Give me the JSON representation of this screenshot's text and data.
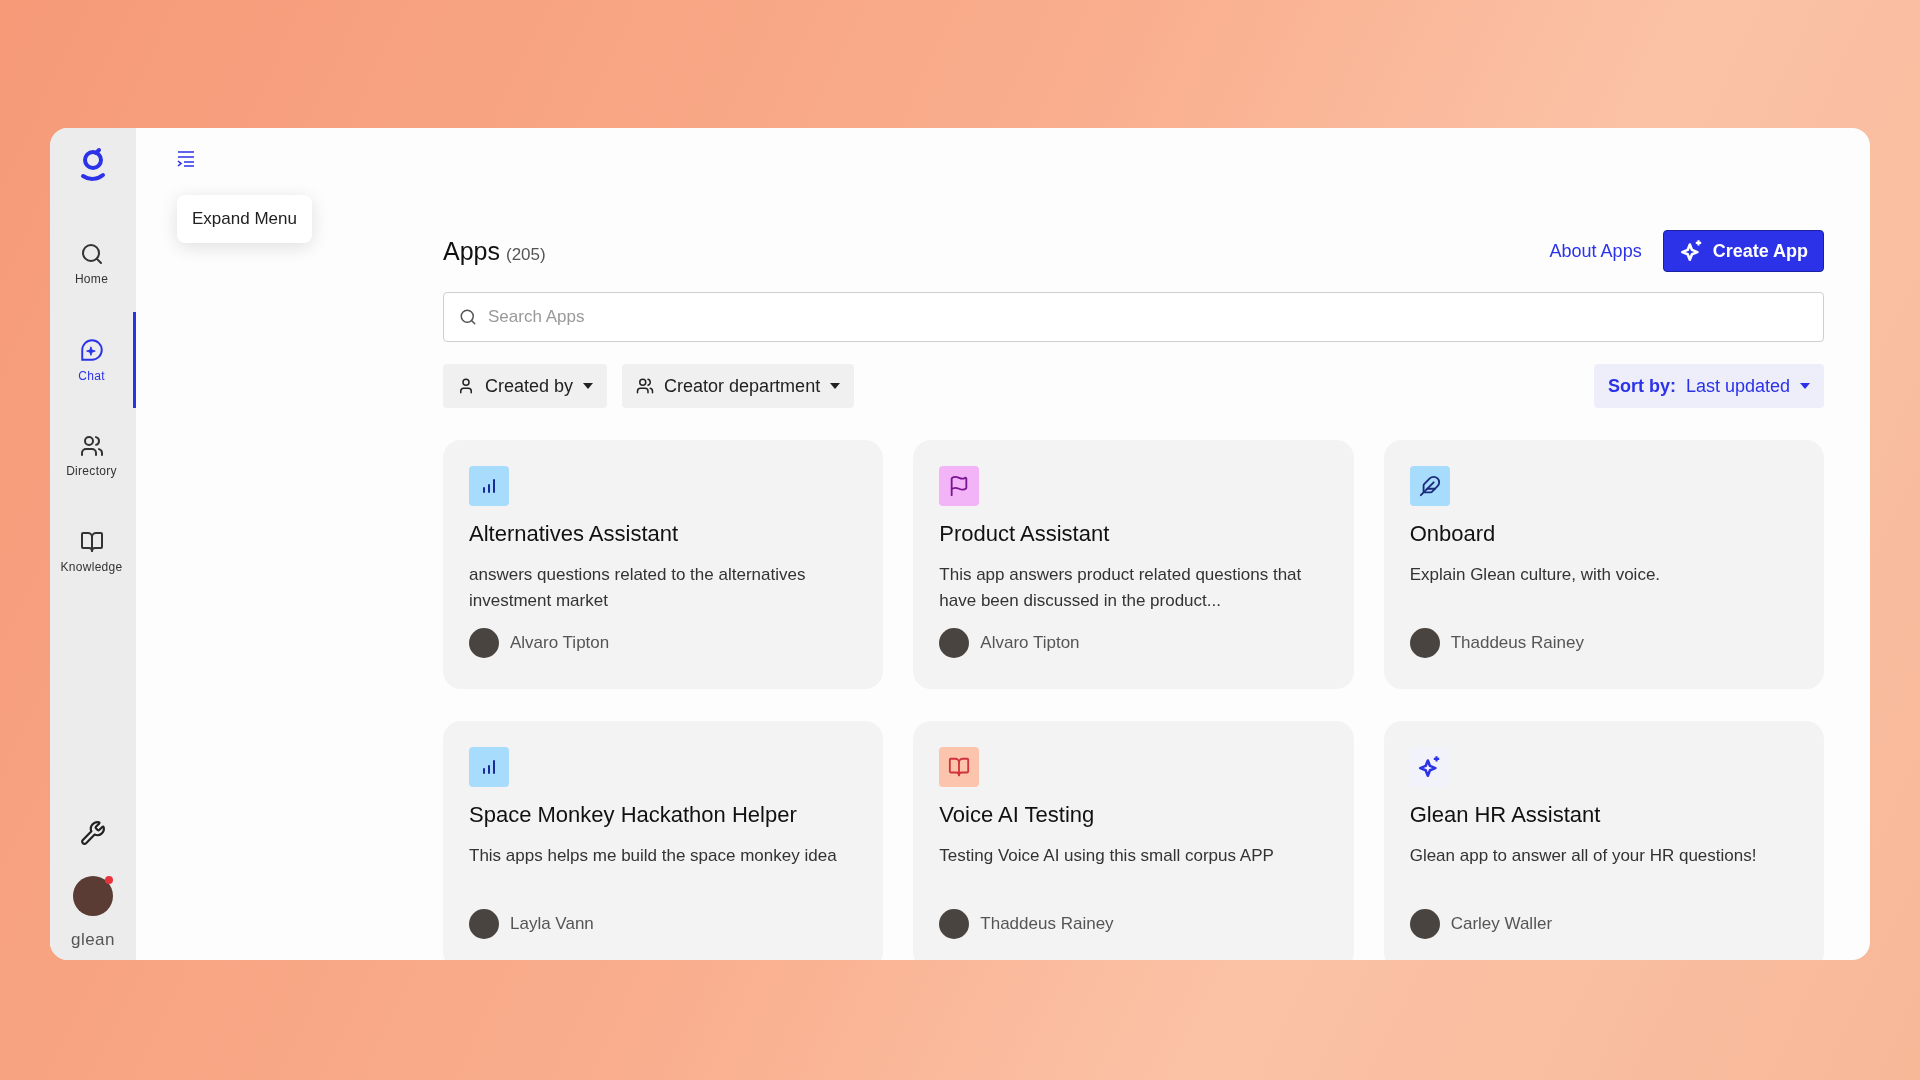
{
  "sidebar": {
    "items": [
      {
        "label": "Home",
        "kind": "search",
        "selected": false
      },
      {
        "label": "Chat",
        "kind": "chat",
        "selected": true
      },
      {
        "label": "Directory",
        "kind": "people",
        "selected": false
      },
      {
        "label": "Knowledge",
        "kind": "book",
        "selected": false
      }
    ],
    "brand": "glean"
  },
  "tooltip": {
    "text": "Expand Menu"
  },
  "header": {
    "title": "Apps",
    "count": "(205)",
    "link": "About Apps",
    "button": "Create App"
  },
  "search": {
    "placeholder": "Search Apps"
  },
  "filters": [
    {
      "label": "Created by",
      "kind": "person"
    },
    {
      "label": "Creator department",
      "kind": "people"
    }
  ],
  "sort": {
    "label": "Sort by:",
    "value": "Last updated"
  },
  "apps": [
    {
      "title": "Alternatives Assistant",
      "description": "answers questions related to the alternatives investment market",
      "author": "Alvaro Tipton",
      "kind": "chart",
      "color": "#a8dcfc"
    },
    {
      "title": "Product Assistant",
      "description": "This app answers product related questions that have been discussed in the product...",
      "author": "Alvaro Tipton",
      "kind": "flag",
      "color": "#f2b3f7"
    },
    {
      "title": "Onboard",
      "description": "Explain Glean culture, with voice.",
      "author": "Thaddeus Rainey",
      "kind": "feather",
      "color": "#a8dcfc"
    },
    {
      "title": "Space Monkey Hackathon Helper",
      "description": "This apps helps me build the space monkey idea",
      "author": "Layla Vann",
      "kind": "chart",
      "color": "#a8dcfc"
    },
    {
      "title": "Voice AI Testing",
      "description": "Testing Voice AI using this small corpus APP",
      "author": "Thaddeus Rainey",
      "kind": "book",
      "color": "#fcc3ad"
    },
    {
      "title": "Glean HR Assistant",
      "description": "Glean app to answer all of your HR questions!",
      "author": "Carley Waller",
      "kind": "sparkle",
      "color": "#f2f2fb"
    }
  ]
}
